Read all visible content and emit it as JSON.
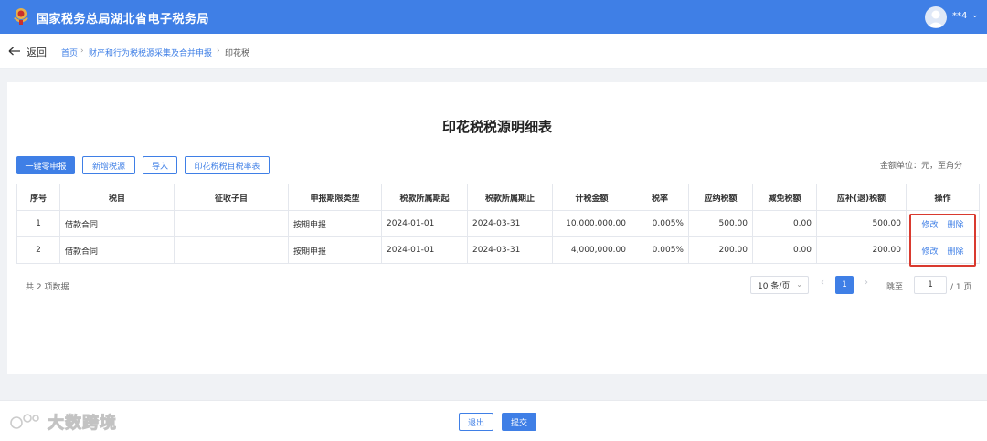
{
  "header": {
    "title": "国家税务总局湖北省电子税务局",
    "username": "**4"
  },
  "nav": {
    "back_label": "返回",
    "breadcrumb": [
      "首页",
      "财产和行为税税源采集及合并申报",
      "印花税"
    ]
  },
  "page": {
    "title": "印花税税源明细表",
    "unit_note": "金额单位：元，至角分"
  },
  "toolbar": {
    "zero_report": "一键零申报",
    "add_source": "新增税源",
    "import": "导入",
    "rate_table": "印花税税目税率表"
  },
  "table": {
    "columns": [
      "序号",
      "税目",
      "征收子目",
      "申报期限类型",
      "税款所属期起",
      "税款所属期止",
      "计税金额",
      "税率",
      "应纳税额",
      "减免税额",
      "应补(退)税额",
      "操作"
    ],
    "rows": [
      {
        "no": "1",
        "item": "借款合同",
        "sub_item": "",
        "period_type": "按期申报",
        "start": "2024-01-01",
        "end": "2024-03-31",
        "amount": "10,000,000.00",
        "rate": "0.005%",
        "payable": "500.00",
        "relief": "0.00",
        "due": "500.00"
      },
      {
        "no": "2",
        "item": "借款合同",
        "sub_item": "",
        "period_type": "按期申报",
        "start": "2024-01-01",
        "end": "2024-03-31",
        "amount": "4,000,000.00",
        "rate": "0.005%",
        "payable": "200.00",
        "relief": "0.00",
        "due": "200.00"
      }
    ],
    "actions": {
      "edit": "修改",
      "delete": "删除"
    }
  },
  "pagination": {
    "total_text": "共 2 项数据",
    "page_size": "10 条/页",
    "current_page": "1",
    "jump_label": "跳至",
    "jump_value": "1",
    "total_pages": "/ 1 页"
  },
  "footer": {
    "exit": "退出",
    "submit": "提交"
  },
  "watermark": "大数跨境",
  "colors": {
    "primary": "#3f7fe6",
    "highlight": "#d93a2f"
  }
}
